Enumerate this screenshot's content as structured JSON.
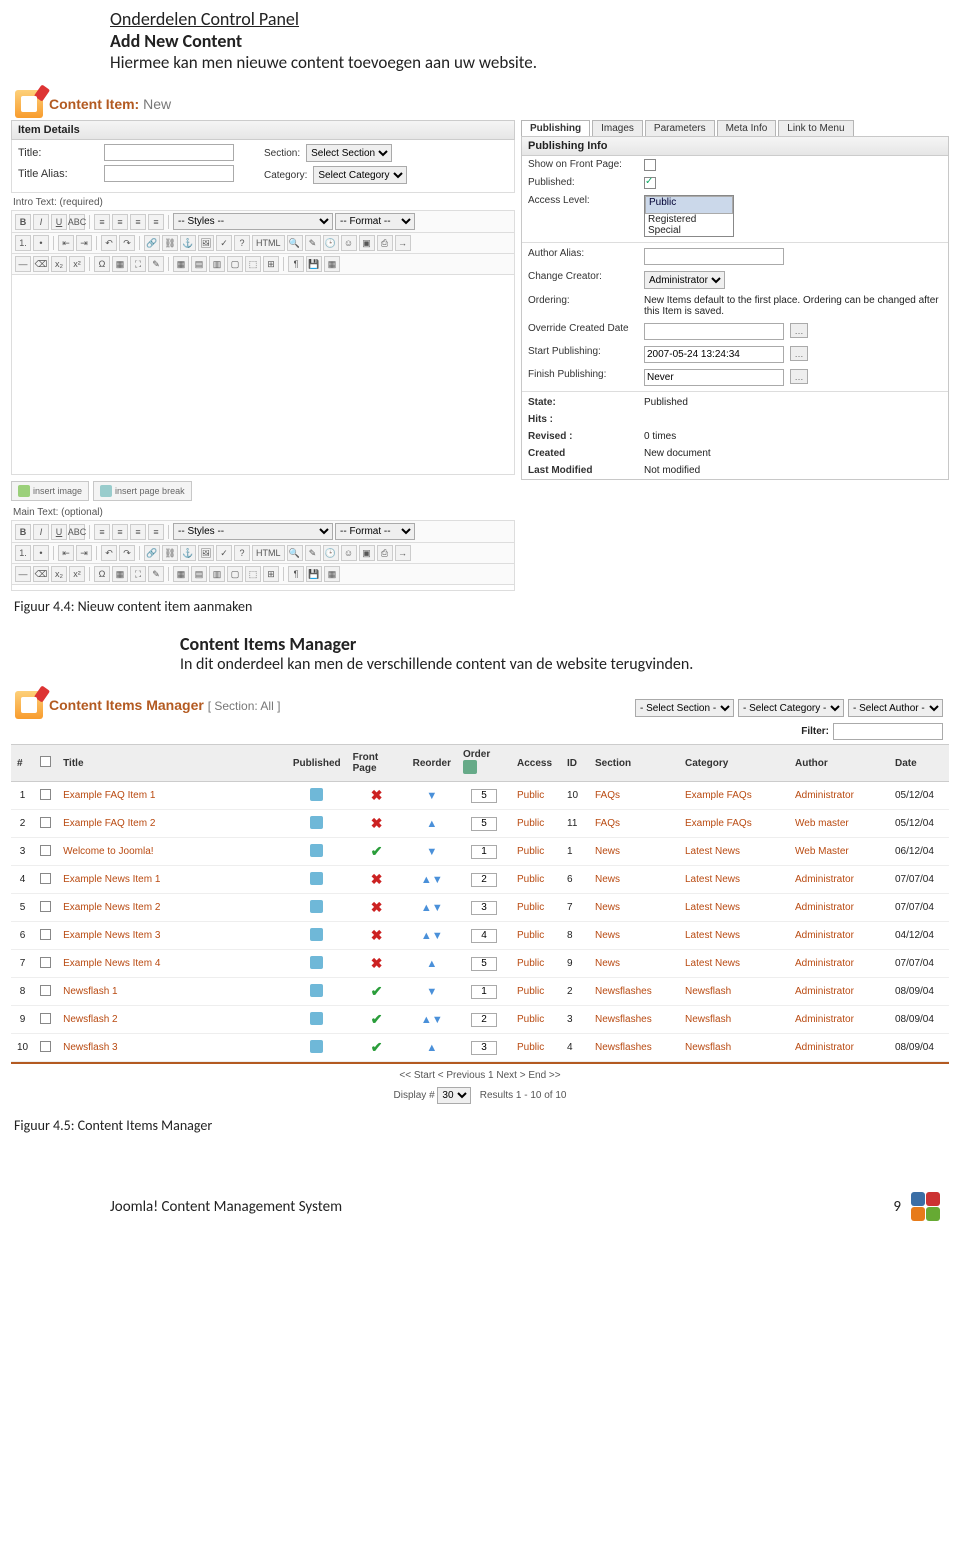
{
  "doc": {
    "section_title": "Onderdelen Control Panel",
    "add_new": "Add New Content",
    "add_new_desc": "Hiermee kan men nieuwe content toevoegen aan uw website.",
    "fig44": "Figuur 4.4: Nieuw content item aanmaken",
    "cim_heading": "Content Items Manager",
    "cim_desc": "In dit onderdeel kan men de verschillende content van de website terugvinden.",
    "fig45": "Figuur 4.5: Content Items Manager",
    "footer": "Joomla! Content Management System",
    "page_num": "9"
  },
  "content_item": {
    "header": "Content Item:",
    "header_mode": "New",
    "item_details": "Item Details",
    "title_lbl": "Title:",
    "title_alias_lbl": "Title Alias:",
    "section_lbl": "Section:",
    "section_sel": "Select Section",
    "category_lbl": "Category:",
    "category_sel": "Select Category",
    "intro_lbl": "Intro Text: (required)",
    "main_lbl": "Main Text: (optional)",
    "styles": "-- Styles --",
    "format": "-- Format --",
    "insert_image": "insert image",
    "insert_pagebreak": "insert page break"
  },
  "tabs": {
    "publishing": "Publishing",
    "images": "Images",
    "parameters": "Parameters",
    "meta": "Meta Info",
    "link": "Link to Menu"
  },
  "pub": {
    "head": "Publishing Info",
    "show_front": "Show on Front Page:",
    "published": "Published:",
    "access": "Access Level:",
    "access_opts": [
      "Public",
      "Registered",
      "Special"
    ],
    "author_alias": "Author Alias:",
    "change_creator": "Change Creator:",
    "creator_val": "Administrator",
    "ordering": "Ordering:",
    "ordering_val": "New Items default to the first place. Ordering can be changed after this Item is saved.",
    "override": "Override Created Date",
    "start_pub": "Start Publishing:",
    "start_pub_val": "2007-05-24 13:24:34",
    "finish_pub": "Finish Publishing:",
    "finish_pub_val": "Never",
    "state": "State:",
    "state_val": "Published",
    "hits": "Hits :",
    "hits_val": "",
    "revised": "Revised :",
    "revised_val": "0 times",
    "created": "Created",
    "created_val": "New document",
    "last_mod": "Last Modified",
    "last_mod_val": "Not modified"
  },
  "cim": {
    "header": "Content Items Manager",
    "header_sub": "[ Section: All ]",
    "sel_section": "- Select Section -",
    "sel_category": "- Select Category -",
    "sel_author": "- Select Author -",
    "filter_lbl": "Filter:",
    "cols": {
      "num": "#",
      "title": "Title",
      "published": "Published",
      "frontpage": "Front Page",
      "reorder": "Reorder",
      "order": "Order",
      "access": "Access",
      "id": "ID",
      "section": "Section",
      "category": "Category",
      "author": "Author",
      "date": "Date"
    },
    "rows": [
      {
        "n": "1",
        "title": "Example FAQ Item 1",
        "fp": "x",
        "re": "d",
        "order": "5",
        "access": "Public",
        "id": "10",
        "section": "FAQs",
        "category": "Example FAQs",
        "author": "Administrator",
        "date": "05/12/04"
      },
      {
        "n": "2",
        "title": "Example FAQ Item 2",
        "fp": "x",
        "re": "u",
        "order": "5",
        "access": "Public",
        "id": "11",
        "section": "FAQs",
        "category": "Example FAQs",
        "author": "Web master",
        "date": "05/12/04"
      },
      {
        "n": "3",
        "title": "Welcome to Joomla!",
        "fp": "v",
        "re": "d",
        "order": "1",
        "access": "Public",
        "id": "1",
        "section": "News",
        "category": "Latest News",
        "author": "Web Master",
        "date": "06/12/04"
      },
      {
        "n": "4",
        "title": "Example News Item 1",
        "fp": "x",
        "re": "ud",
        "order": "2",
        "access": "Public",
        "id": "6",
        "section": "News",
        "category": "Latest News",
        "author": "Administrator",
        "date": "07/07/04"
      },
      {
        "n": "5",
        "title": "Example News Item 2",
        "fp": "x",
        "re": "ud",
        "order": "3",
        "access": "Public",
        "id": "7",
        "section": "News",
        "category": "Latest News",
        "author": "Administrator",
        "date": "07/07/04"
      },
      {
        "n": "6",
        "title": "Example News Item 3",
        "fp": "x",
        "re": "ud",
        "order": "4",
        "access": "Public",
        "id": "8",
        "section": "News",
        "category": "Latest News",
        "author": "Administrator",
        "date": "04/12/04"
      },
      {
        "n": "7",
        "title": "Example News Item 4",
        "fp": "x",
        "re": "u",
        "order": "5",
        "access": "Public",
        "id": "9",
        "section": "News",
        "category": "Latest News",
        "author": "Administrator",
        "date": "07/07/04"
      },
      {
        "n": "8",
        "title": "Newsflash 1",
        "fp": "v",
        "re": "d",
        "order": "1",
        "access": "Public",
        "id": "2",
        "section": "Newsflashes",
        "category": "Newsflash",
        "author": "Administrator",
        "date": "08/09/04"
      },
      {
        "n": "9",
        "title": "Newsflash 2",
        "fp": "v",
        "re": "ud",
        "order": "2",
        "access": "Public",
        "id": "3",
        "section": "Newsflashes",
        "category": "Newsflash",
        "author": "Administrator",
        "date": "08/09/04"
      },
      {
        "n": "10",
        "title": "Newsflash 3",
        "fp": "v",
        "re": "u",
        "order": "3",
        "access": "Public",
        "id": "4",
        "section": "Newsflashes",
        "category": "Newsflash",
        "author": "Administrator",
        "date": "08/09/04"
      }
    ],
    "pager": "<< Start < Previous 1 Next > End >>",
    "display_lbl": "Display #",
    "display_val": "30",
    "results": "Results 1 - 10 of 10"
  }
}
